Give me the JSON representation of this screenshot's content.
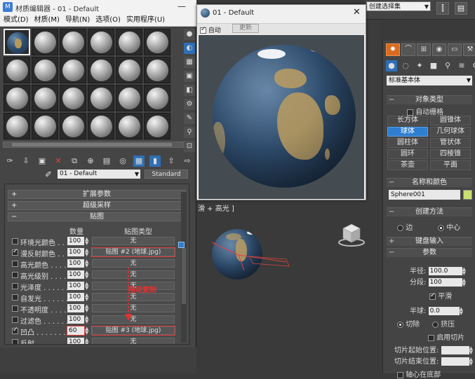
{
  "main": {
    "selection_set_placeholder": "创建选择集",
    "viewport_label": "滑 + 高光 ]"
  },
  "command_panel": {
    "primitive_type": "标准基本体",
    "object_type_header": "对象类型",
    "autogrid_label": "自动栅格",
    "object_buttons": [
      "长方体",
      "圆锥体",
      "球体",
      "几何球体",
      "圆柱体",
      "管状体",
      "圆环",
      "四棱锥",
      "茶壶",
      "平面"
    ],
    "active_object": "球体",
    "name_color_header": "名称和颜色",
    "object_name": "Sphere001",
    "object_color": "#c8e070",
    "creation_method_header": "创建方法",
    "edge_label": "边",
    "center_label": "中心",
    "keyboard_entry_header": "键盘输入",
    "parameters_header": "参数",
    "radius_label": "半径:",
    "radius_value": "100.0",
    "segments_label": "分段:",
    "segments_value": "100",
    "smooth_label": "平滑",
    "hemisphere_label": "半球:",
    "hemisphere_value": "0.0",
    "chop_label": "切除",
    "squash_label": "挤压",
    "slice_on_label": "启用切片",
    "slice_from_label": "切片起始位置:",
    "slice_to_label": "切片结束位置:",
    "axis_pivot_label": "轴心在底部"
  },
  "material_editor": {
    "title": "材质编辑器 - 01 - Default",
    "menu": [
      "模式(D)",
      "材质(M)",
      "导航(N)",
      "选项(O)",
      "实用程序(U)"
    ],
    "material_name": "01 - Default",
    "material_type": "Standard",
    "rollouts": {
      "extended": "扩展参数",
      "supersampling": "超级采样",
      "maps": "贴图"
    },
    "col_amount": "数量",
    "col_map_type": "贴图类型",
    "maps": [
      {
        "label": "环境光颜色 . .",
        "amount": "100",
        "map": "无",
        "checked": false
      },
      {
        "label": "漫反射颜色 . .",
        "amount": "100",
        "map": "贴图 #2 (地球.jpg)",
        "checked": true
      },
      {
        "label": "高光颜色 . . . .",
        "amount": "100",
        "map": "无",
        "checked": false
      },
      {
        "label": "高光级别 . . . .",
        "amount": "100",
        "map": "无",
        "checked": false
      },
      {
        "label": "光泽度 . . . . . .",
        "amount": "100",
        "map": "无",
        "checked": false
      },
      {
        "label": "自发光 . . . . . .",
        "amount": "100",
        "map": "无",
        "checked": false
      },
      {
        "label": "不透明度 . . . .",
        "amount": "100",
        "map": "无",
        "checked": false
      },
      {
        "label": "过滤色 . . . . . .",
        "amount": "100",
        "map": "无",
        "checked": false
      },
      {
        "label": "凹凸 . . . . . . . .",
        "amount": "60",
        "map": "贴图 #3 (地球.jpg)",
        "checked": true
      },
      {
        "label": "反射 . . . . . . . .",
        "amount": "100",
        "map": "无",
        "checked": false
      }
    ],
    "annotation": "拖动复制"
  },
  "render_window": {
    "title": "01 - Default",
    "auto_label": "自动",
    "update_label": "更新"
  },
  "colors": {
    "accent_orange": "#d96b1e",
    "selection_blue": "#2f7fd0",
    "highlight_red": "#e23a3a"
  }
}
